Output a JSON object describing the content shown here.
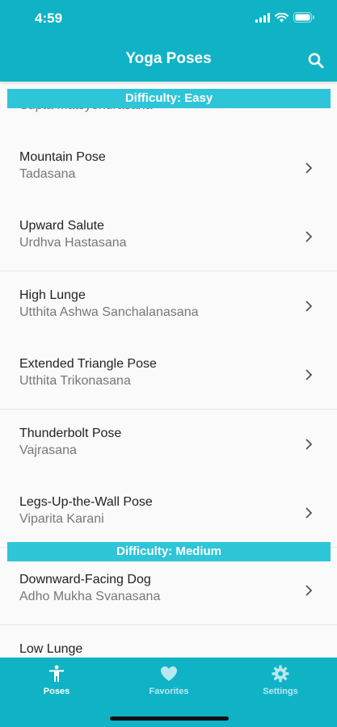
{
  "status_bar": {
    "time": "4:59"
  },
  "nav": {
    "title": "Yoga Poses",
    "search_icon": "search-icon"
  },
  "sections": [
    {
      "header": "Difficulty: Easy"
    },
    {
      "header": "Difficulty: Medium"
    }
  ],
  "easy_partial_top": {
    "subtitle": "Supta Matsyendrasana"
  },
  "easy_poses": [
    {
      "title": "Mountain Pose",
      "subtitle": "Tadasana"
    },
    {
      "title": "Upward Salute",
      "subtitle": "Urdhva Hastasana"
    },
    {
      "title": "High Lunge",
      "subtitle": "Utthita Ashwa Sanchalanasana"
    },
    {
      "title": "Extended Triangle Pose",
      "subtitle": "Utthita Trikonasana"
    },
    {
      "title": "Thunderbolt Pose",
      "subtitle": "Vajrasana"
    },
    {
      "title": "Legs-Up-the-Wall Pose",
      "subtitle": "Viparita Karani"
    }
  ],
  "medium_poses": [
    {
      "title": "Downward-Facing Dog",
      "subtitle": "Adho Mukha Svanasana"
    },
    {
      "title": "Low Lunge",
      "subtitle": ""
    }
  ],
  "tabs": [
    {
      "label": "Poses",
      "icon": "person-icon",
      "active": true
    },
    {
      "label": "Favorites",
      "icon": "heart-icon",
      "active": false
    },
    {
      "label": "Settings",
      "icon": "gear-icon",
      "active": false
    }
  ],
  "colors": {
    "primary": "#0fb3c5",
    "section": "#2ec5d8"
  }
}
